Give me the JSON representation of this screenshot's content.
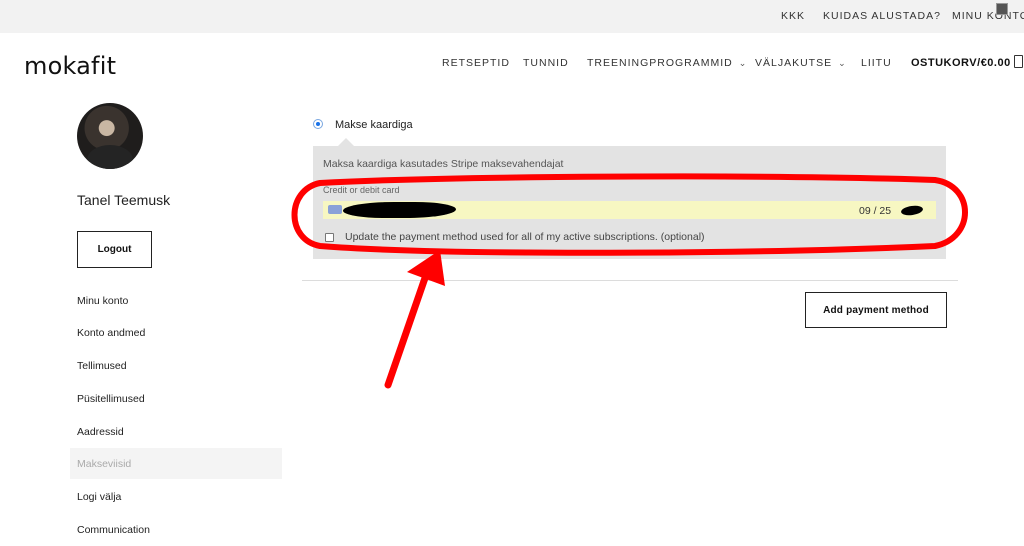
{
  "topbar": {
    "links": [
      "KKK",
      "KUIDAS ALUSTADA?",
      "MINU KONTO"
    ]
  },
  "header": {
    "logo": "mokafit",
    "nav": [
      {
        "label": "RETSEPTID",
        "has_dropdown": false
      },
      {
        "label": "TUNNID",
        "has_dropdown": false
      },
      {
        "label": "TREENINGPROGRAMMID",
        "has_dropdown": true
      },
      {
        "label": "VÄLJAKUTSE",
        "has_dropdown": true
      },
      {
        "label": "LIITU",
        "has_dropdown": false
      }
    ],
    "cart_label": "OSTUKORV/€0.00"
  },
  "sidebar": {
    "user_name": "Tanel Teemusk",
    "logout_label": "Logout",
    "menu": [
      {
        "label": "Minu konto",
        "active": false
      },
      {
        "label": "Konto andmed",
        "active": false
      },
      {
        "label": "Tellimused",
        "active": false
      },
      {
        "label": "Püsitellimused",
        "active": false
      },
      {
        "label": "Aadressid",
        "active": false
      },
      {
        "label": "Makseviisid",
        "active": true
      },
      {
        "label": "Logi välja",
        "active": false
      },
      {
        "label": "Communication",
        "active": false
      }
    ]
  },
  "payment": {
    "method_label": "Makse kaardiga",
    "description": "Maksa kaardiga kasutades Stripe maksevahendajat",
    "card_label": "Credit or debit card",
    "card_expiry": "09 / 25",
    "update_all_label": "Update the payment method used for all of my active subscriptions. (optional)",
    "add_button": "Add payment method"
  },
  "colors": {
    "annotation_red": "#ff0000",
    "card_field_bg": "#f7f7c2",
    "panel_bg": "#e3e3e3",
    "radio_blue": "#1a73e8"
  }
}
